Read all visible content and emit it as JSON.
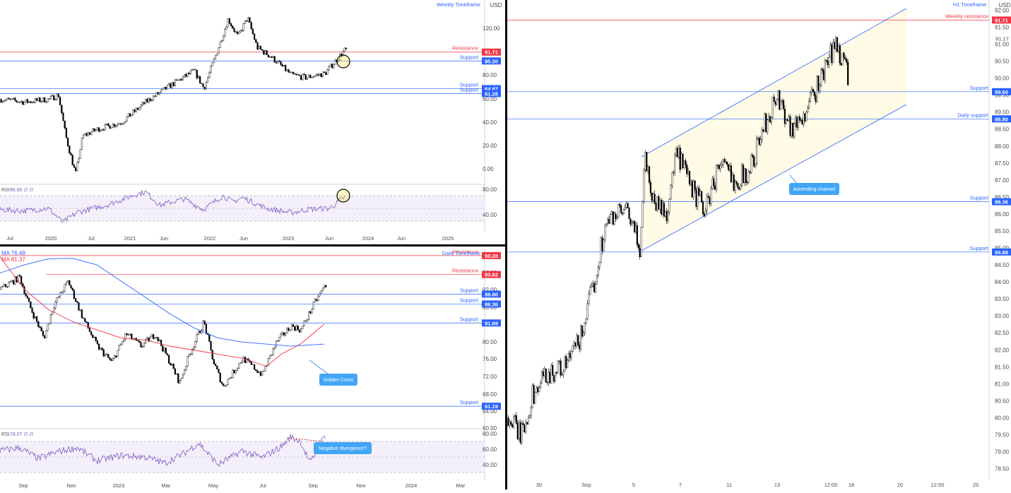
{
  "chart_data": [
    {
      "id": "weekly",
      "type": "candlestick",
      "title": "Weekly Timeframe",
      "currency": "USD",
      "y_ticks": [
        "120.00",
        "100.00",
        "80.00",
        "60.00",
        "40.00",
        "20.00",
        "0.00"
      ],
      "x_ticks": [
        "Jul",
        "2020",
        "Jul",
        "2021",
        "Jun",
        "2022",
        "Jun",
        "2023",
        "Jun",
        "2024",
        "Jun",
        "2025"
      ],
      "levels": [
        {
          "name": "Resistance",
          "value": 91.71,
          "badge": "91.71",
          "kind": "resistance"
        },
        {
          "name": "Support",
          "value": 85.2,
          "badge": "85.20",
          "kind": "support"
        },
        {
          "name": "Support",
          "value": 64.87,
          "badge": "64.87",
          "kind": "support"
        },
        {
          "name": "Support",
          "value": 61.28,
          "badge": "61.28",
          "kind": "support"
        }
      ],
      "price_path": [
        [
          0,
          57
        ],
        [
          0.05,
          55
        ],
        [
          0.1,
          57
        ],
        [
          0.12,
          60
        ],
        [
          0.135,
          30
        ],
        [
          0.155,
          2
        ],
        [
          0.17,
          30
        ],
        [
          0.2,
          35
        ],
        [
          0.25,
          40
        ],
        [
          0.3,
          55
        ],
        [
          0.35,
          67
        ],
        [
          0.4,
          78
        ],
        [
          0.42,
          65
        ],
        [
          0.45,
          95
        ],
        [
          0.47,
          116
        ],
        [
          0.49,
          103
        ],
        [
          0.51,
          117
        ],
        [
          0.53,
          95
        ],
        [
          0.56,
          88
        ],
        [
          0.6,
          75
        ],
        [
          0.63,
          73
        ],
        [
          0.67,
          76
        ],
        [
          0.71,
          93
        ]
      ],
      "rsi": {
        "label": "RSI",
        "value": "66.60",
        "y_ticks": [
          "80.00",
          "40.00"
        ],
        "upper": 70,
        "lower": 30,
        "path": [
          [
            0,
            48
          ],
          [
            0.05,
            46
          ],
          [
            0.1,
            50
          ],
          [
            0.13,
            28
          ],
          [
            0.16,
            44
          ],
          [
            0.22,
            55
          ],
          [
            0.28,
            72
          ],
          [
            0.3,
            76
          ],
          [
            0.33,
            55
          ],
          [
            0.38,
            65
          ],
          [
            0.42,
            48
          ],
          [
            0.46,
            70
          ],
          [
            0.48,
            60
          ],
          [
            0.5,
            67
          ],
          [
            0.55,
            50
          ],
          [
            0.6,
            43
          ],
          [
            0.64,
            49
          ],
          [
            0.68,
            50
          ],
          [
            0.71,
            67
          ]
        ]
      }
    },
    {
      "id": "daily",
      "type": "candlestick",
      "title": "Daily Timeframe",
      "ma_labels": [
        "MA  76.48",
        "MA  81.37"
      ],
      "y_ticks": [
        "96.00",
        "92.00",
        "88.00",
        "84.00",
        "80.00",
        "76.00",
        "72.00",
        "68.00",
        "64.00",
        "60.00"
      ],
      "x_ticks": [
        "Sep",
        "Nov",
        "2023",
        "Mar",
        "May",
        "Jul",
        "Sep",
        "Nov",
        "2024",
        "Mar"
      ],
      "levels": [
        {
          "name": "Resistance",
          "value": 98.28,
          "badge": "98.28",
          "kind": "resistance"
        },
        {
          "name": "Resistance",
          "value": 93.62,
          "badge": "93.62",
          "kind": "resistance"
        },
        {
          "name": "Support",
          "value": 88.8,
          "badge": "88.80",
          "kind": "support"
        },
        {
          "name": "Support",
          "value": 86.36,
          "badge": "86.36",
          "kind": "support"
        },
        {
          "name": "Support",
          "value": 81.69,
          "badge": "81.69",
          "kind": "support"
        },
        {
          "name": "Support",
          "value": 61.19,
          "badge": "61.19",
          "kind": "support"
        }
      ],
      "annotations": [
        "Golden Cross",
        "Negative divergence?"
      ],
      "price_path": [
        [
          0,
          90
        ],
        [
          0.04,
          93
        ],
        [
          0.06,
          86
        ],
        [
          0.09,
          78
        ],
        [
          0.11,
          86
        ],
        [
          0.14,
          92
        ],
        [
          0.17,
          83
        ],
        [
          0.2,
          76
        ],
        [
          0.23,
          72
        ],
        [
          0.26,
          79
        ],
        [
          0.29,
          76
        ],
        [
          0.32,
          79
        ],
        [
          0.35,
          72
        ],
        [
          0.37,
          67
        ],
        [
          0.39,
          74
        ],
        [
          0.42,
          82
        ],
        [
          0.44,
          72
        ],
        [
          0.46,
          66
        ],
        [
          0.5,
          73
        ],
        [
          0.54,
          69
        ],
        [
          0.57,
          77
        ],
        [
          0.6,
          81
        ],
        [
          0.62,
          80
        ],
        [
          0.65,
          87
        ],
        [
          0.67,
          91
        ]
      ],
      "ma_fast": [
        [
          0,
          98
        ],
        [
          0.05,
          90
        ],
        [
          0.1,
          85
        ],
        [
          0.15,
          82
        ],
        [
          0.2,
          80
        ],
        [
          0.25,
          78
        ],
        [
          0.3,
          77.5
        ],
        [
          0.35,
          76
        ],
        [
          0.4,
          75
        ],
        [
          0.45,
          74
        ],
        [
          0.5,
          73
        ],
        [
          0.55,
          71
        ],
        [
          0.58,
          74
        ],
        [
          0.62,
          76.5
        ],
        [
          0.67,
          81.5
        ]
      ],
      "ma_slow": [
        [
          0,
          94
        ],
        [
          0.05,
          96
        ],
        [
          0.1,
          97.5
        ],
        [
          0.15,
          97.6
        ],
        [
          0.2,
          96
        ],
        [
          0.25,
          92
        ],
        [
          0.3,
          88
        ],
        [
          0.35,
          84
        ],
        [
          0.4,
          80.5
        ],
        [
          0.45,
          78
        ],
        [
          0.5,
          77
        ],
        [
          0.55,
          76.5
        ],
        [
          0.6,
          76
        ],
        [
          0.67,
          76.5
        ]
      ],
      "rsi": {
        "label": "RSI",
        "value": "78.07",
        "y_ticks": [
          "80.00",
          "60.00",
          "40.00"
        ],
        "upper": 70,
        "lower": 30,
        "path": [
          [
            0,
            58
          ],
          [
            0.04,
            62
          ],
          [
            0.08,
            48
          ],
          [
            0.12,
            57
          ],
          [
            0.16,
            62
          ],
          [
            0.2,
            45
          ],
          [
            0.25,
            52
          ],
          [
            0.3,
            50
          ],
          [
            0.34,
            42
          ],
          [
            0.38,
            55
          ],
          [
            0.41,
            68
          ],
          [
            0.45,
            40
          ],
          [
            0.5,
            58
          ],
          [
            0.54,
            49
          ],
          [
            0.58,
            63
          ],
          [
            0.6,
            76
          ],
          [
            0.62,
            70
          ],
          [
            0.64,
            42
          ],
          [
            0.67,
            78
          ]
        ]
      }
    },
    {
      "id": "h1",
      "type": "candlestick",
      "title": "H1 Timeframe",
      "currency": "USD",
      "y_ticks": [
        "92.00",
        "91.50",
        "91.00",
        "90.50",
        "90.00",
        "89.50",
        "89.00",
        "88.50",
        "88.00",
        "87.50",
        "87.00",
        "86.50",
        "86.00",
        "85.50",
        "85.00",
        "84.50",
        "84.00",
        "83.50",
        "83.00",
        "82.50",
        "82.00",
        "81.50",
        "81.00",
        "80.50",
        "80.00",
        "79.50",
        "79.00",
        "78.50"
      ],
      "x_ticks": [
        "30",
        "Sep",
        "5",
        "7",
        "11",
        "13",
        "12:00",
        "18",
        "20",
        "12:00",
        "25"
      ],
      "last_price": "91.17",
      "levels": [
        {
          "name": "Weekly resistance",
          "value": 91.71,
          "badge": "91.71",
          "kind": "resistance"
        },
        {
          "name": "Support",
          "value": 89.6,
          "badge": "89.60",
          "kind": "support"
        },
        {
          "name": "Daily support",
          "value": 88.8,
          "badge": "88.80",
          "kind": "support"
        },
        {
          "name": "Support",
          "value": 86.36,
          "badge": "86.36",
          "kind": "support"
        },
        {
          "name": "Support",
          "value": 84.88,
          "badge": "84.88",
          "kind": "support"
        }
      ],
      "annotations": [
        "Ascending channel"
      ],
      "price_path": [
        [
          0,
          80
        ],
        [
          0.03,
          79.5
        ],
        [
          0.05,
          80.6
        ],
        [
          0.08,
          81.3
        ],
        [
          0.12,
          81.5
        ],
        [
          0.15,
          82.3
        ],
        [
          0.18,
          84
        ],
        [
          0.2,
          85.5
        ],
        [
          0.22,
          86
        ],
        [
          0.25,
          86
        ],
        [
          0.275,
          85
        ],
        [
          0.285,
          87.8
        ],
        [
          0.3,
          86.5
        ],
        [
          0.33,
          86
        ],
        [
          0.35,
          87.8
        ],
        [
          0.38,
          86.8
        ],
        [
          0.41,
          86.1
        ],
        [
          0.44,
          87.5
        ],
        [
          0.47,
          87
        ],
        [
          0.5,
          87.2
        ],
        [
          0.53,
          88.5
        ],
        [
          0.56,
          89.5
        ],
        [
          0.59,
          88.5
        ],
        [
          0.62,
          89
        ],
        [
          0.65,
          90
        ],
        [
          0.68,
          91
        ],
        [
          0.7,
          90.5
        ],
        [
          0.71,
          89.8
        ],
        [
          0.72,
          90.8
        ],
        [
          0.74,
          91.2
        ]
      ]
    }
  ]
}
